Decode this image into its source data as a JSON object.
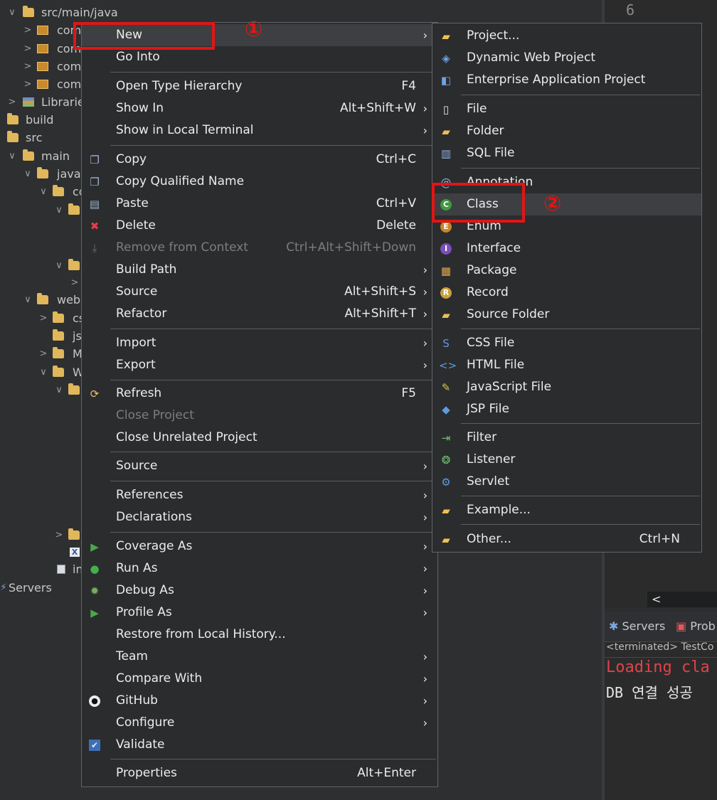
{
  "explorer": {
    "rows": [
      {
        "text": "src/main/java",
        "tw": "∨"
      },
      {
        "text": "com",
        "tw": ">"
      },
      {
        "text": "com",
        "tw": ">"
      },
      {
        "text": "com",
        "tw": ">"
      },
      {
        "text": "com",
        "tw": ">"
      },
      {
        "text": "Libraries",
        "tw": ">"
      },
      {
        "text": "build",
        "tw": ""
      },
      {
        "text": "src",
        "tw": ""
      },
      {
        "text": "main",
        "tw": "∨"
      },
      {
        "text": "java",
        "tw": "∨"
      },
      {
        "text": "co",
        "tw": "∨"
      },
      {
        "text": "weba",
        "tw": "∨"
      },
      {
        "text": "cs",
        "tw": ">"
      },
      {
        "text": "js",
        "tw": ""
      },
      {
        "text": "M",
        "tw": ">"
      },
      {
        "text": "W",
        "tw": "∨"
      },
      {
        "text": "in",
        "tw": ""
      },
      {
        "text": "Servers",
        "tw": ""
      }
    ]
  },
  "editor": {
    "line_number": "6",
    "scroll_left": "<"
  },
  "console": {
    "tabs": {
      "servers": "Servers",
      "problems": "Prob"
    },
    "status": "<terminated> TestCo",
    "line1": "Loading cla",
    "line2": "DB 연결 성공"
  },
  "context_menu": {
    "new": {
      "label": "New",
      "arrow": "›"
    },
    "go_into": {
      "label": "Go Into"
    },
    "open_type_hierarchy": {
      "label": "Open Type Hierarchy",
      "shortcut": "F4"
    },
    "show_in": {
      "label": "Show In",
      "shortcut": "Alt+Shift+W",
      "arrow": "›"
    },
    "show_in_local_terminal": {
      "label": "Show in Local Terminal",
      "arrow": "›"
    },
    "copy": {
      "label": "Copy",
      "shortcut": "Ctrl+C"
    },
    "copy_qualified_name": {
      "label": "Copy Qualified Name"
    },
    "paste": {
      "label": "Paste",
      "shortcut": "Ctrl+V"
    },
    "delete": {
      "label": "Delete",
      "shortcut": "Delete"
    },
    "remove_from_context": {
      "label": "Remove from Context",
      "shortcut": "Ctrl+Alt+Shift+Down"
    },
    "build_path": {
      "label": "Build Path",
      "arrow": "›"
    },
    "source1": {
      "label": "Source",
      "shortcut": "Alt+Shift+S",
      "arrow": "›"
    },
    "refactor": {
      "label": "Refactor",
      "shortcut": "Alt+Shift+T",
      "arrow": "›"
    },
    "import": {
      "label": "Import",
      "arrow": "›"
    },
    "export": {
      "label": "Export",
      "arrow": "›"
    },
    "refresh": {
      "label": "Refresh",
      "shortcut": "F5"
    },
    "close_project": {
      "label": "Close Project"
    },
    "close_unrelated_project": {
      "label": "Close Unrelated Project"
    },
    "source2": {
      "label": "Source",
      "arrow": "›"
    },
    "references": {
      "label": "References",
      "arrow": "›"
    },
    "declarations": {
      "label": "Declarations",
      "arrow": "›"
    },
    "coverage_as": {
      "label": "Coverage As",
      "arrow": "›"
    },
    "run_as": {
      "label": "Run As",
      "arrow": "›"
    },
    "debug_as": {
      "label": "Debug As",
      "arrow": "›"
    },
    "profile_as": {
      "label": "Profile As",
      "arrow": "›"
    },
    "restore_local_history": {
      "label": "Restore from Local History..."
    },
    "team": {
      "label": "Team",
      "arrow": "›"
    },
    "compare_with": {
      "label": "Compare With",
      "arrow": "›"
    },
    "github": {
      "label": "GitHub",
      "arrow": "›"
    },
    "configure": {
      "label": "Configure",
      "arrow": "›"
    },
    "validate": {
      "label": "Validate"
    },
    "properties": {
      "label": "Properties",
      "shortcut": "Alt+Enter"
    }
  },
  "submenu": {
    "project": "Project...",
    "dynamic_web_project": "Dynamic Web Project",
    "enterprise_application_project": "Enterprise Application Project",
    "file": "File",
    "folder": "Folder",
    "sql_file": "SQL File",
    "annotation": "Annotation",
    "class": "Class",
    "enum": "Enum",
    "interface": "Interface",
    "package": "Package",
    "record": "Record",
    "source_folder": "Source Folder",
    "css_file": "CSS File",
    "html_file": "HTML File",
    "javascript_file": "JavaScript File",
    "jsp_file": "JSP File",
    "filter": "Filter",
    "listener": "Listener",
    "servlet": "Servlet",
    "example": "Example...",
    "other": "Other...",
    "other_shortcut": "Ctrl+N"
  },
  "annotations": {
    "step1": "①",
    "step2": "②"
  },
  "colors": {
    "annotation_red": "#e01616",
    "menu_bg": "#2b2c2e",
    "highlight": "#3d3f42"
  }
}
